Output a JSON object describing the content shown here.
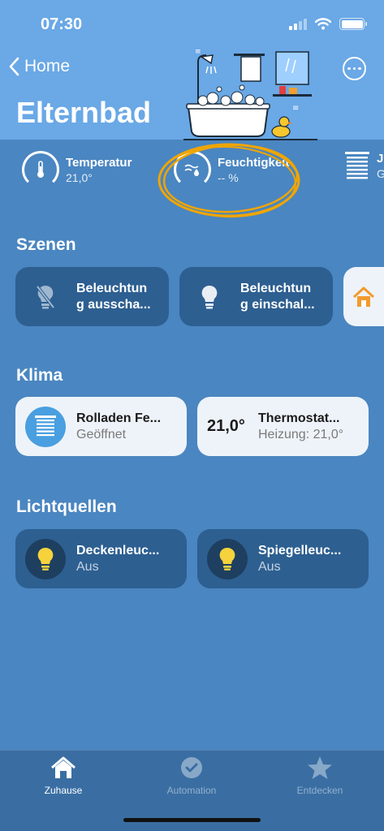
{
  "status": {
    "time": "07:30"
  },
  "header": {
    "back_label": "Home",
    "title": "Elternbad"
  },
  "sensors": [
    {
      "name": "Temperatur",
      "value": "21,0°",
      "icon": "thermometer-icon"
    },
    {
      "name": "Feuchtigkeit",
      "value": "-- %",
      "icon": "humidity-icon"
    },
    {
      "name": "J",
      "value": "G",
      "icon": "blinds-icon"
    }
  ],
  "sections": {
    "scenes": {
      "title": "Szenen",
      "items": [
        {
          "line1": "Beleuchtun",
          "line2": "g ausscha...",
          "icon": "bulb-off-icon"
        },
        {
          "line1": "Beleuchtun",
          "line2": "g einschal...",
          "icon": "bulb-on-icon"
        },
        {
          "icon": "home-icon"
        }
      ]
    },
    "climate": {
      "title": "Klima",
      "items": [
        {
          "name": "Rolladen Fe...",
          "status": "Geöffnet",
          "icon": "blinds-icon"
        },
        {
          "badge": "21,0°",
          "name": "Thermostat...",
          "status": "Heizung: 21,0°"
        }
      ]
    },
    "lights": {
      "title": "Lichtquellen",
      "items": [
        {
          "name": "Deckenleuc...",
          "status": "Aus",
          "icon": "lightbulb-icon"
        },
        {
          "name": "Spiegelleuc...",
          "status": "Aus",
          "icon": "lightbulb-icon"
        }
      ]
    }
  },
  "tabs": [
    {
      "label": "Zuhause",
      "icon": "house-icon",
      "active": true
    },
    {
      "label": "Automation",
      "icon": "clock-check-icon",
      "active": false
    },
    {
      "label": "Entdecken",
      "icon": "star-icon",
      "active": false
    }
  ],
  "colors": {
    "accent_ring": "#f0a500",
    "tile_dark": "#2d5f91",
    "tile_light": "#eef3f9",
    "bulb_yellow": "#f6d33c"
  }
}
